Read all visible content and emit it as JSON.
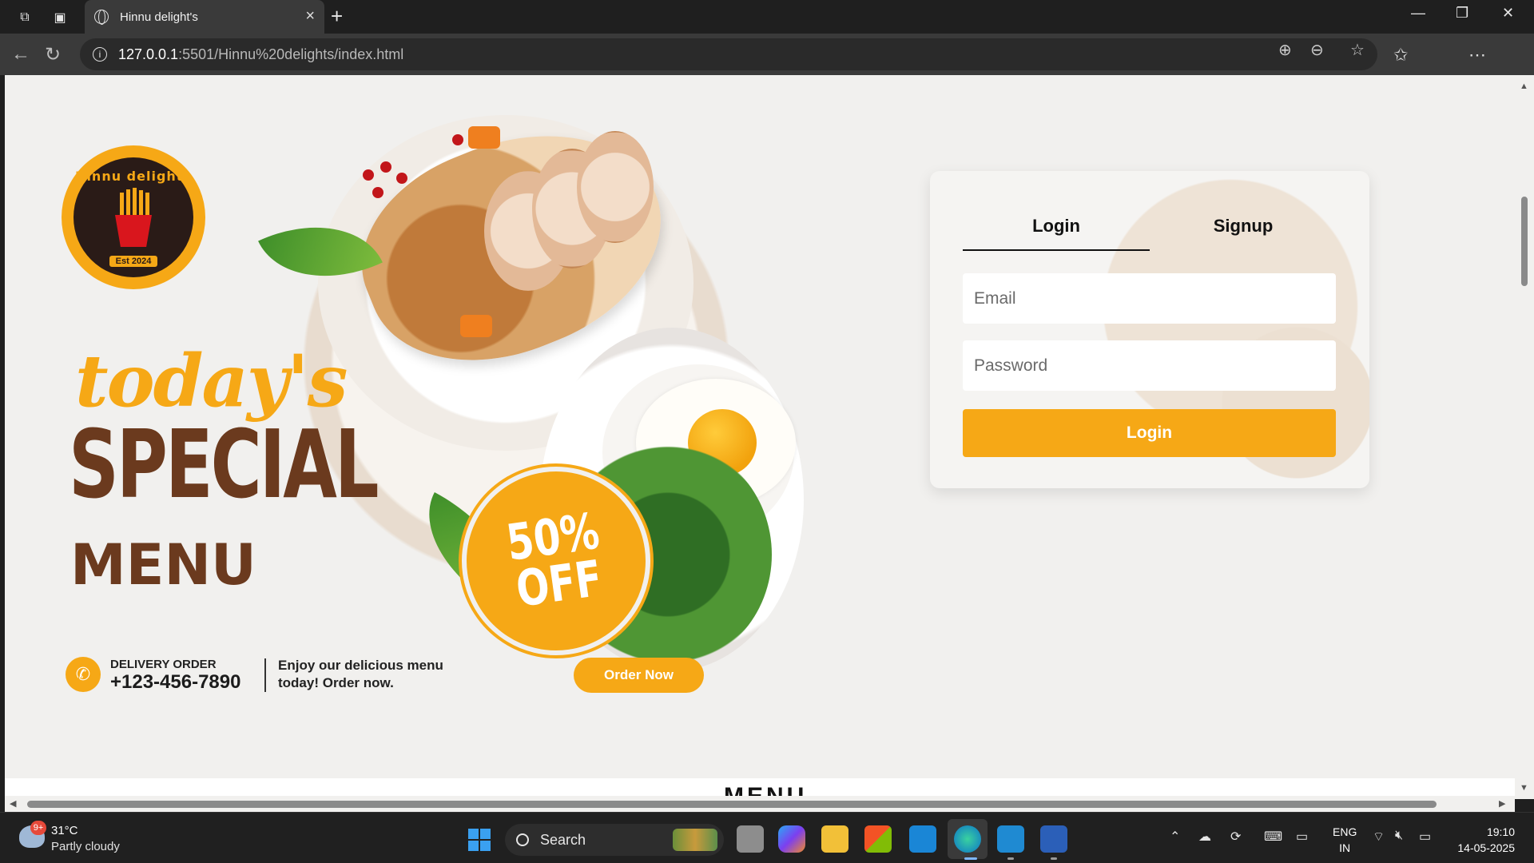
{
  "browser": {
    "tab_title": "Hinnu delight's",
    "url_host": "127.0.0.1",
    "url_path": ":5501/Hinnu%20delights/index.html",
    "window_controls": {
      "minimize": "—",
      "restore": "❐",
      "close": "✕"
    }
  },
  "poster": {
    "logo_name": "Hinnu delights",
    "logo_est": "Est 2024",
    "headline_script": "today's",
    "headline_main": "SPECIAL",
    "headline_sub": "MENU",
    "badge_line1": "50%",
    "badge_line2": "OFF",
    "delivery_label": "DELIVERY ORDER",
    "delivery_phone": "+123-456-7890",
    "promo_text": "Enjoy our delicious menu today! Order now.",
    "order_button": "Order Now",
    "colors": {
      "accent": "#f6a816",
      "brown": "#6b3a1e"
    }
  },
  "auth": {
    "tabs": [
      {
        "label": "Login",
        "active": true
      },
      {
        "label": "Signup",
        "active": false
      }
    ],
    "email_placeholder": "Email",
    "password_placeholder": "Password",
    "submit_label": "Login"
  },
  "below_fold_title": "MENU",
  "taskbar": {
    "weather_badge": "9+",
    "temperature": "31°C",
    "condition": "Partly cloudy",
    "search_label": "Search",
    "language_line1": "ENG",
    "language_line2": "IN",
    "time": "19:10",
    "date": "14-05-2025"
  }
}
